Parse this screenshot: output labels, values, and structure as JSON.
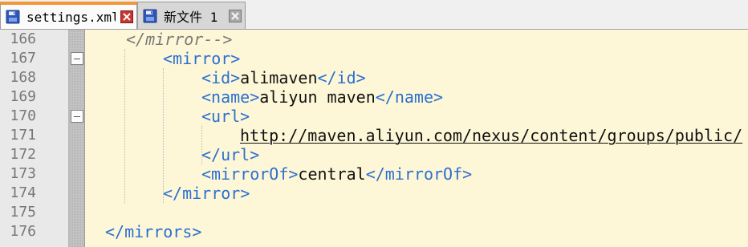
{
  "tabs": [
    {
      "label": "settings.xml",
      "active": true,
      "icon": "floppy-disk-icon",
      "close_icon": "close-icon"
    },
    {
      "label": "新文件 1",
      "active": false,
      "icon": "floppy-disk-icon",
      "close_icon": "close-icon"
    }
  ],
  "editor": {
    "lines": [
      {
        "number": "166",
        "fold": false,
        "tokens": [
          {
            "text": "</mirror-->",
            "kind": "comment"
          }
        ]
      },
      {
        "number": "167",
        "fold": true,
        "tokens": [
          {
            "text": "<mirror>",
            "kind": "tag"
          }
        ]
      },
      {
        "number": "168",
        "fold": false,
        "tokens": [
          {
            "text": "<id>",
            "kind": "tag"
          },
          {
            "text": "alimaven",
            "kind": "text"
          },
          {
            "text": "</id>",
            "kind": "tag"
          }
        ]
      },
      {
        "number": "169",
        "fold": false,
        "tokens": [
          {
            "text": "<name>",
            "kind": "tag"
          },
          {
            "text": "aliyun maven",
            "kind": "text"
          },
          {
            "text": "</name>",
            "kind": "tag"
          }
        ]
      },
      {
        "number": "170",
        "fold": true,
        "tokens": [
          {
            "text": "<url>",
            "kind": "tag"
          }
        ]
      },
      {
        "number": "171",
        "fold": false,
        "tokens": [
          {
            "text": "http://maven.aliyun.com/nexus/content/groups/public/",
            "kind": "url"
          }
        ]
      },
      {
        "number": "172",
        "fold": false,
        "tokens": [
          {
            "text": "</url>",
            "kind": "tag"
          }
        ]
      },
      {
        "number": "173",
        "fold": false,
        "tokens": [
          {
            "text": "<mirrorOf>",
            "kind": "tag"
          },
          {
            "text": "central",
            "kind": "text"
          },
          {
            "text": "</mirrorOf>",
            "kind": "tag"
          }
        ]
      },
      {
        "number": "174",
        "fold": false,
        "tokens": [
          {
            "text": "</mirror>",
            "kind": "tag"
          }
        ]
      },
      {
        "number": "175",
        "fold": false,
        "tokens": []
      },
      {
        "number": "176",
        "fold": false,
        "tokens": [
          {
            "text": "</mirrors>",
            "kind": "tag"
          }
        ]
      }
    ]
  },
  "colors": {
    "tag": "#2b6fd1",
    "comment": "#7a7a7a",
    "editor_background": "#fef7d7",
    "gutter_background": "#e9e9e9",
    "active_tab_accent": "#f29638"
  }
}
